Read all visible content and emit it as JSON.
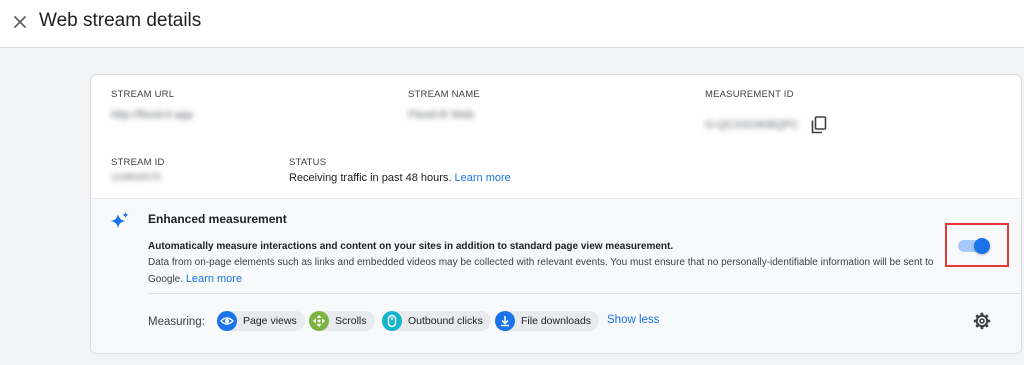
{
  "header": {
    "title": "Web stream details"
  },
  "stream_details": {
    "stream_url_label": "STREAM URL",
    "stream_url_value": "http://flood-it.app",
    "stream_name_label": "STREAM NAME",
    "stream_name_value": "Flood-It! Web",
    "measurement_id_label": "MEASUREMENT ID",
    "measurement_id_value": "G-QCXSOIKBQPC",
    "stream_id_label": "STREAM ID",
    "stream_id_value": "2148025070",
    "status_label": "STATUS",
    "status_text": "Receiving traffic in past 48 hours.",
    "status_link": "Learn more"
  },
  "enhanced_measurement": {
    "title": "Enhanced measurement",
    "description_bold": "Automatically measure interactions and content on your sites in addition to standard page view measurement.",
    "description": "Data from on-page elements such as links and embedded videos may be collected with relevant events. You must ensure that no personally-identifiable information will be sent to Google.",
    "learn_more": "Learn more",
    "enabled": true,
    "measuring_label": "Measuring:",
    "chips": [
      {
        "label": "Page views",
        "icon": "eye-icon",
        "color": "#1a73e8"
      },
      {
        "label": "Scrolls",
        "icon": "scroll-arrows-icon",
        "color": "#7cb342"
      },
      {
        "label": "Outbound clicks",
        "icon": "mouse-icon",
        "color": "#12b5cb"
      },
      {
        "label": "File downloads",
        "icon": "download-icon",
        "color": "#1a73e8"
      }
    ],
    "show_less": "Show less"
  },
  "colors": {
    "accent": "#1a73e8",
    "highlight_border": "#e53935",
    "toggle_track": "#a8c7fa"
  }
}
